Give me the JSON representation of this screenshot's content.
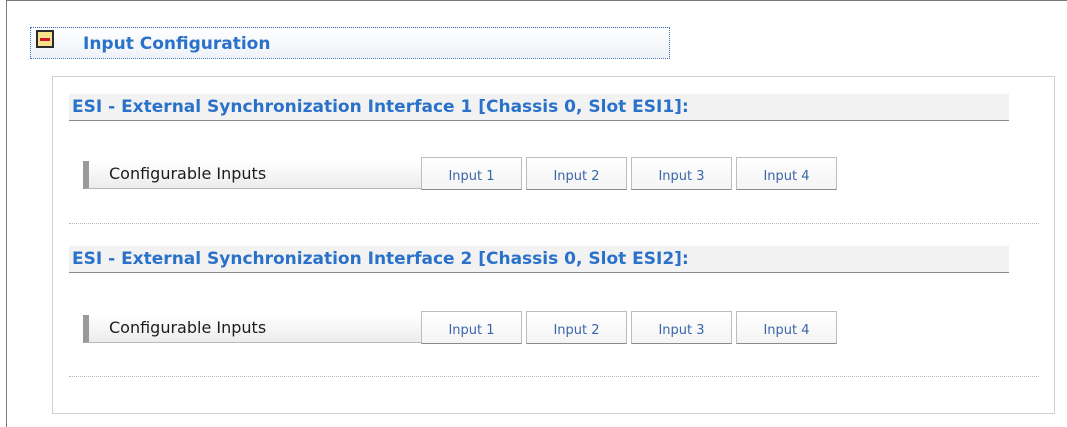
{
  "section": {
    "title": "Input Configuration",
    "collapse_icon": "minus-icon"
  },
  "interfaces": [
    {
      "title": "ESI - External Synchronization Interface 1 [Chassis 0, Slot ESI1]:",
      "row_label": "Configurable Inputs",
      "tabs": [
        "Input 1",
        "Input 2",
        "Input 3",
        "Input 4"
      ]
    },
    {
      "title": "ESI - External Synchronization Interface 2 [Chassis 0, Slot ESI2]:",
      "row_label": "Configurable Inputs",
      "tabs": [
        "Input 1",
        "Input 2",
        "Input 3",
        "Input 4"
      ]
    }
  ],
  "colors": {
    "accent_blue": "#2a72c9",
    "tab_text": "#3a66a8",
    "collapse_fill": "#f7e18a",
    "collapse_bar": "#d0142a"
  }
}
